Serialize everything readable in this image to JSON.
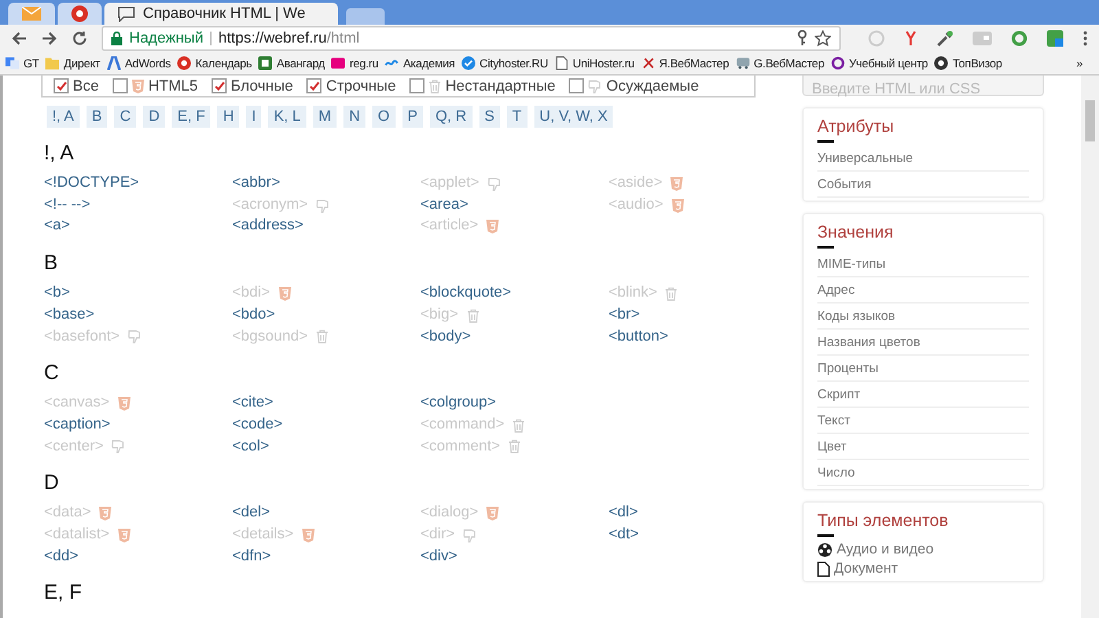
{
  "browser": {
    "tabs": [
      {
        "kind": "mail",
        "selected": false
      },
      {
        "kind": "opera",
        "selected": false
      },
      {
        "kind": "page",
        "selected": true,
        "title": "Справочник HTML | We"
      }
    ],
    "security": "Надежный",
    "url_origin": "https://webref.ru",
    "url_path": "/html",
    "bookmarks": [
      {
        "kind": "apps",
        "label": "GT"
      },
      {
        "kind": "folder",
        "label": "Директ"
      },
      {
        "kind": "adwords",
        "label": "AdWords"
      },
      {
        "kind": "calendar",
        "label": "Календарь"
      },
      {
        "kind": "avangard",
        "label": "Авангард"
      },
      {
        "kind": "regru",
        "label": "reg.ru"
      },
      {
        "kind": "wave",
        "label": "Академия"
      },
      {
        "kind": "check",
        "label": "Cityhoster.RU"
      },
      {
        "kind": "doc",
        "label": "UniHoster.ru"
      },
      {
        "kind": "ya",
        "label": "Я.ВебМастер"
      },
      {
        "kind": "bus",
        "label": "G.ВебМастер"
      },
      {
        "kind": "ring",
        "label": "Учебный центр"
      },
      {
        "kind": "eye",
        "label": "ТопВизор"
      }
    ],
    "more": "»"
  },
  "filters": [
    {
      "label": "Все",
      "checked": true,
      "kind": "plain"
    },
    {
      "label": "HTML5",
      "checked": false,
      "kind": "html5"
    },
    {
      "label": "Блочные",
      "checked": true,
      "kind": "plain"
    },
    {
      "label": "Строчные",
      "checked": true,
      "kind": "plain"
    },
    {
      "label": "Нестандартные",
      "checked": false,
      "kind": "nonstandard"
    },
    {
      "label": "Осуждаемые",
      "checked": false,
      "kind": "deprecated"
    }
  ],
  "letters": [
    "!, A",
    "B",
    "C",
    "D",
    "E, F",
    "H",
    "I",
    "K, L",
    "M",
    "N",
    "O",
    "P",
    "Q, R",
    "S",
    "T",
    "U, V, W, X"
  ],
  "sections": [
    {
      "title": "!, A",
      "rows": [
        [
          {
            "tag": "<!DOCTYPE>",
            "kind": "standard"
          },
          {
            "tag": "<abbr>",
            "kind": "standard"
          },
          {
            "tag": "<applet>",
            "kind": "deprecated"
          },
          {
            "tag": "<aside>",
            "kind": "html5"
          }
        ],
        [
          {
            "tag": "<!-- -->",
            "kind": "standard"
          },
          {
            "tag": "<acronym>",
            "kind": "deprecated"
          },
          {
            "tag": "<area>",
            "kind": "standard"
          },
          {
            "tag": "<audio>",
            "kind": "html5"
          }
        ],
        [
          {
            "tag": "<a>",
            "kind": "standard"
          },
          {
            "tag": "<address>",
            "kind": "standard"
          },
          {
            "tag": "<article>",
            "kind": "html5"
          }
        ]
      ]
    },
    {
      "title": "B",
      "rows": [
        [
          {
            "tag": "<b>",
            "kind": "standard"
          },
          {
            "tag": "<bdi>",
            "kind": "html5"
          },
          {
            "tag": "<blockquote>",
            "kind": "standard"
          },
          {
            "tag": "<blink>",
            "kind": "nonstandard"
          }
        ],
        [
          {
            "tag": "<base>",
            "kind": "standard"
          },
          {
            "tag": "<bdo>",
            "kind": "standard"
          },
          {
            "tag": "<big>",
            "kind": "nonstandard"
          },
          {
            "tag": "<br>",
            "kind": "standard"
          }
        ],
        [
          {
            "tag": "<basefont>",
            "kind": "deprecated"
          },
          {
            "tag": "<bgsound>",
            "kind": "nonstandard"
          },
          {
            "tag": "<body>",
            "kind": "standard"
          },
          {
            "tag": "<button>",
            "kind": "standard"
          }
        ]
      ]
    },
    {
      "title": "C",
      "rows": [
        [
          {
            "tag": "<canvas>",
            "kind": "html5"
          },
          {
            "tag": "<cite>",
            "kind": "standard"
          },
          {
            "tag": "<colgroup>",
            "kind": "standard"
          }
        ],
        [
          {
            "tag": "<caption>",
            "kind": "standard"
          },
          {
            "tag": "<code>",
            "kind": "standard"
          },
          {
            "tag": "<command>",
            "kind": "nonstandard"
          }
        ],
        [
          {
            "tag": "<center>",
            "kind": "deprecated"
          },
          {
            "tag": "<col>",
            "kind": "standard"
          },
          {
            "tag": "<comment>",
            "kind": "nonstandard"
          }
        ]
      ]
    },
    {
      "title": "D",
      "rows": [
        [
          {
            "tag": "<data>",
            "kind": "html5"
          },
          {
            "tag": "<del>",
            "kind": "standard"
          },
          {
            "tag": "<dialog>",
            "kind": "html5"
          },
          {
            "tag": "<dl>",
            "kind": "standard"
          }
        ],
        [
          {
            "tag": "<datalist>",
            "kind": "html5"
          },
          {
            "tag": "<details>",
            "kind": "html5"
          },
          {
            "tag": "<dir>",
            "kind": "deprecated"
          },
          {
            "tag": "<dt>",
            "kind": "standard"
          }
        ],
        [
          {
            "tag": "<dd>",
            "kind": "standard"
          },
          {
            "tag": "<dfn>",
            "kind": "standard"
          },
          {
            "tag": "<div>",
            "kind": "standard"
          }
        ]
      ]
    },
    {
      "title": "E, F"
    }
  ],
  "sidebar": {
    "search": {
      "placeholder": "Введите HTML или CSS"
    },
    "cards": [
      {
        "title": "Атрибуты",
        "links": [
          {
            "label": "Универсальные",
            "kind": "plain"
          },
          {
            "label": "События",
            "kind": "plain"
          }
        ]
      },
      {
        "title": "Значения",
        "links": [
          {
            "label": "MIME-типы",
            "kind": "plain"
          },
          {
            "label": "Адрес",
            "kind": "plain"
          },
          {
            "label": "Коды языков",
            "kind": "plain"
          },
          {
            "label": "Названия цветов",
            "kind": "plain"
          },
          {
            "label": "Проценты",
            "kind": "plain"
          },
          {
            "label": "Скрипт",
            "kind": "plain"
          },
          {
            "label": "Текст",
            "kind": "plain"
          },
          {
            "label": "Цвет",
            "kind": "plain"
          },
          {
            "label": "Число",
            "kind": "plain"
          }
        ]
      },
      {
        "title": "Типы элементов",
        "links": [
          {
            "label": "Аудио и видео",
            "kind": "film"
          },
          {
            "label": "Документ",
            "kind": "document"
          }
        ]
      }
    ]
  }
}
